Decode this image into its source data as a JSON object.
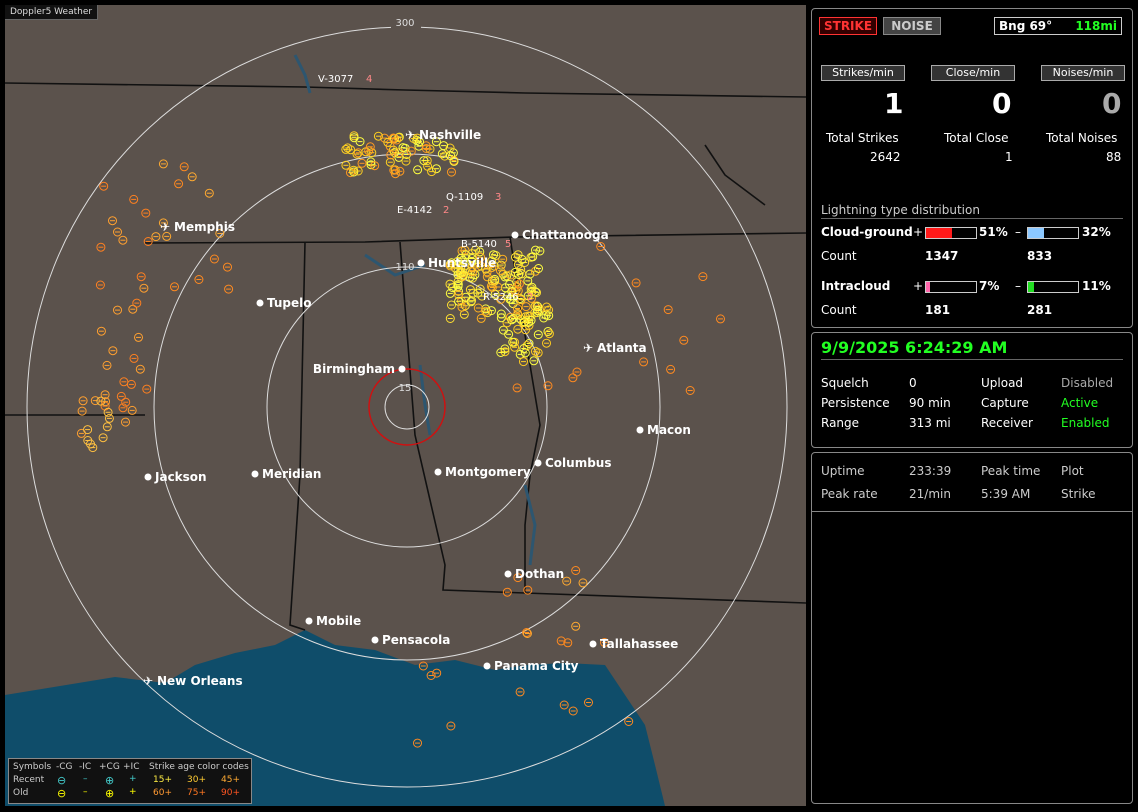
{
  "app_title": "Doppler5 Weather",
  "map": {
    "rings": [
      "300",
      "110",
      "15"
    ],
    "cities": [
      {
        "name": "Nashville",
        "airport": true
      },
      {
        "name": "Memphis",
        "airport": true
      },
      {
        "name": "Chattanooga",
        "airport": false
      },
      {
        "name": "Huntsville",
        "airport": false
      },
      {
        "name": "Tupelo",
        "airport": false
      },
      {
        "name": "Atlanta",
        "airport": true
      },
      {
        "name": "Birmingham",
        "airport": false
      },
      {
        "name": "Macon",
        "airport": false
      },
      {
        "name": "Jackson",
        "airport": false
      },
      {
        "name": "Meridian",
        "airport": false
      },
      {
        "name": "Montgomery",
        "airport": false
      },
      {
        "name": "Columbus",
        "airport": false
      },
      {
        "name": "Dothan",
        "airport": false
      },
      {
        "name": "Mobile",
        "airport": false
      },
      {
        "name": "Pensacola",
        "airport": false
      },
      {
        "name": "Tallahassee",
        "airport": false
      },
      {
        "name": "Panama City",
        "airport": false
      },
      {
        "name": "New Orleans",
        "airport": true
      }
    ],
    "tags": [
      "V-3077",
      "4",
      "Q-1109",
      "3",
      "E-4142",
      "2",
      "B-5140",
      "5",
      "R-5246",
      "2"
    ]
  },
  "legend": {
    "symbols_label": "Symbols",
    "cols": [
      "-CG",
      "-IC",
      "+CG",
      "+IC"
    ],
    "age_label": "Strike age color codes",
    "recent_label": "Recent",
    "old_label": "Old",
    "recent_ages": [
      "15+",
      "30+",
      "45+"
    ],
    "old_ages": [
      "60+",
      "75+",
      "90+"
    ]
  },
  "top": {
    "strike_btn": "STRIKE",
    "noise_btn": "NOISE",
    "bearing": "Bng 69°",
    "distance": "118mi",
    "strikes_min_label": "Strikes/min",
    "close_min_label": "Close/min",
    "noises_min_label": "Noises/min",
    "strikes_min": "1",
    "close_min": "0",
    "noises_min": "0",
    "total_strikes_label": "Total Strikes",
    "total_close_label": "Total Close",
    "total_noises_label": "Total Noises",
    "total_strikes": "2642",
    "total_close": "1",
    "total_noises": "88",
    "dist_title": "Lightning type distribution",
    "cg_label": "Cloud-ground",
    "ic_label": "Intracloud",
    "count_label": "Count",
    "plus": "+",
    "minus": "–",
    "cg_pos_pct": "51%",
    "cg_neg_pct": "32%",
    "cg_pos_count": "1347",
    "cg_neg_count": "833",
    "ic_pos_pct": "7%",
    "ic_neg_pct": "11%",
    "ic_pos_count": "181",
    "ic_neg_count": "281",
    "bars": {
      "cg_pos": 0.51,
      "cg_neg": 0.32,
      "ic_pos": 0.07,
      "ic_neg": 0.11
    },
    "colors": {
      "cg_pos": "#ff1a1a",
      "cg_neg": "#8cc8ff",
      "ic_pos": "#ff66aa",
      "ic_neg": "#22dd22"
    }
  },
  "status": {
    "datetime": "9/9/2025 6:24:29 AM",
    "squelch_label": "Squelch",
    "squelch": "0",
    "persistence_label": "Persistence",
    "persistence": "90 min",
    "range_label": "Range",
    "range": "313 mi",
    "upload_label": "Upload",
    "upload": "Disabled",
    "capture_label": "Capture",
    "capture": "Active",
    "receiver_label": "Receiver",
    "receiver": "Enabled"
  },
  "stats": {
    "uptime_label": "Uptime",
    "uptime": "233:39",
    "peak_time_label": "Peak time",
    "plot_label": "Plot",
    "peak_rate_label": "Peak rate",
    "peak_rate": "21/min",
    "peak_time": "5:39 AM",
    "plot": "Strike"
  }
}
